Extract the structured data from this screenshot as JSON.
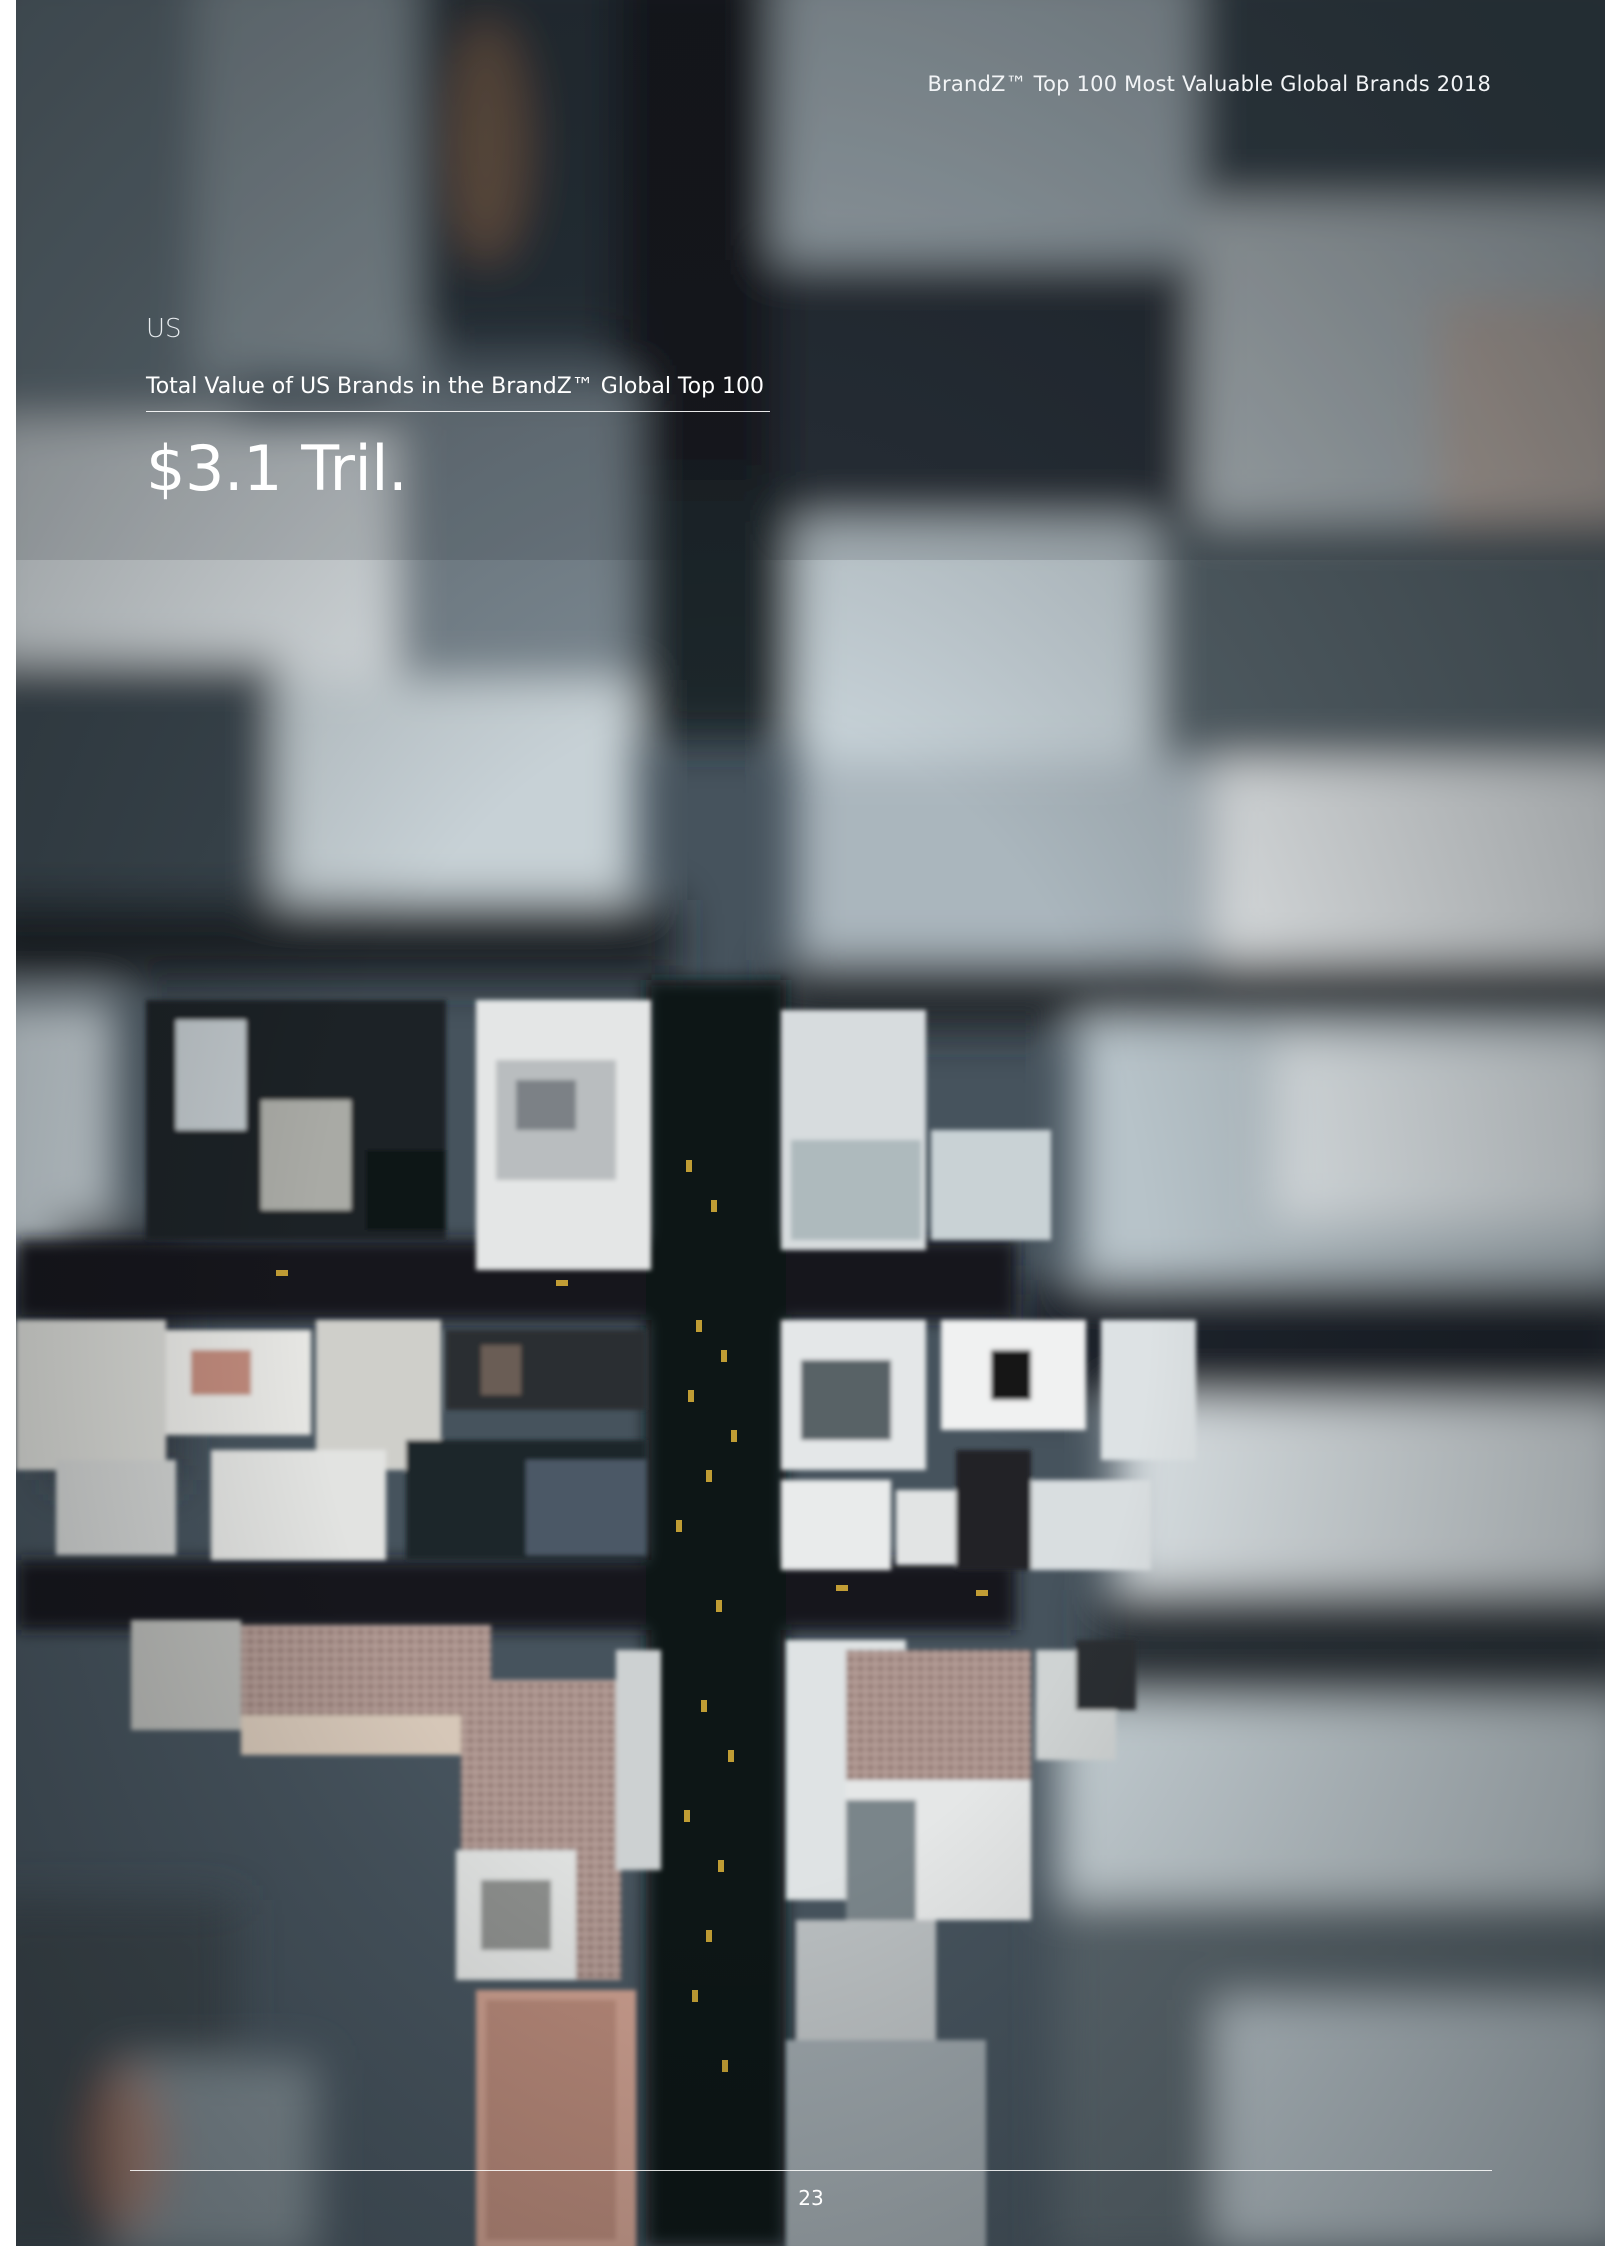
{
  "header": {
    "running_title": "BrandZ™ Top 100 Most Valuable Global Brands 2018"
  },
  "section": {
    "label": "US"
  },
  "stat": {
    "caption": "Total Value of US Brands in the BrandZ™ Global Top 100",
    "value": "$3.1 Tril."
  },
  "footer": {
    "page_number": "23"
  },
  "background": {
    "description_colors": [
      "#3a4650",
      "#1b2127",
      "#c9d3da",
      "#e3c3b6",
      "#d9a93a"
    ]
  }
}
